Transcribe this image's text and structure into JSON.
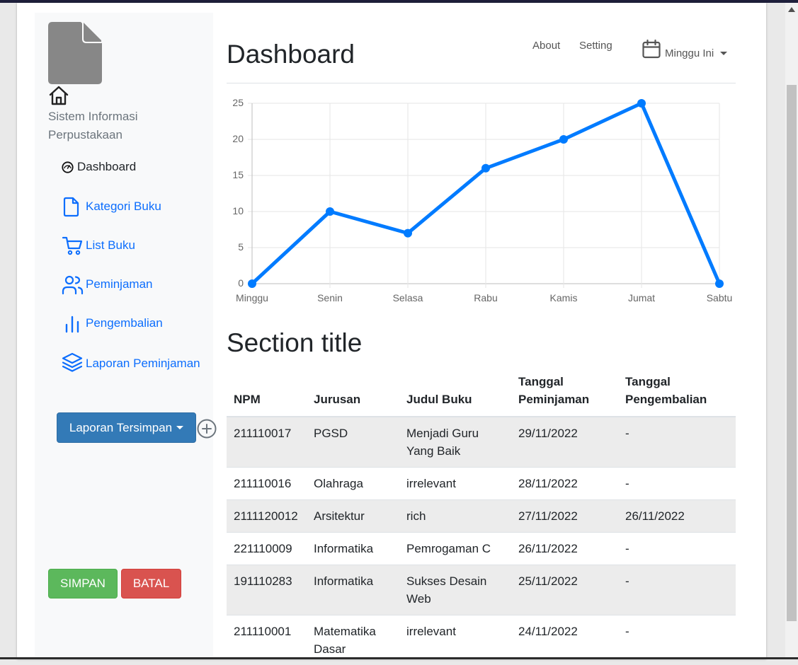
{
  "app": {
    "title": "Sistem Informasi Perpustakaan"
  },
  "sidebar": {
    "items": [
      {
        "label": "Dashboard",
        "icon": "speedometer-icon",
        "active": true
      },
      {
        "label": "Kategori Buku",
        "icon": "file-icon"
      },
      {
        "label": "List Buku",
        "icon": "cart-icon"
      },
      {
        "label": "Peminjaman",
        "icon": "users-icon"
      },
      {
        "label": "Pengembalian",
        "icon": "bar-chart-icon"
      },
      {
        "label": "Laporan Peminjaman",
        "icon": "layers-icon"
      }
    ],
    "saved_reports_label": "Laporan Tersimpan",
    "save_label": "SIMPAN",
    "cancel_label": "BATAL"
  },
  "header": {
    "title": "Dashboard",
    "links": [
      "About",
      "Setting"
    ],
    "period_label": "Minggu Ini"
  },
  "chart_data": {
    "type": "line",
    "categories": [
      "Minggu",
      "Senin",
      "Selasa",
      "Rabu",
      "Kamis",
      "Jumat",
      "Sabtu"
    ],
    "series": [
      {
        "values": [
          0,
          10,
          7,
          16,
          20,
          25,
          0
        ],
        "color": "#007bff"
      }
    ],
    "ylim": [
      0,
      25
    ],
    "yticks": [
      0,
      5,
      10,
      15,
      20,
      25
    ],
    "grid": true,
    "legend": "none"
  },
  "section": {
    "title": "Section title"
  },
  "table": {
    "headers": [
      "NPM",
      "Jurusan",
      "Judul Buku",
      "Tanggal Peminjaman",
      "Tanggal Pengembalian"
    ],
    "rows": [
      [
        "211110017",
        "PGSD",
        "Menjadi Guru Yang Baik",
        "29/11/2022",
        "-"
      ],
      [
        "211110016",
        "Olahraga",
        "irrelevant",
        "28/11/2022",
        "-"
      ],
      [
        "2111120012",
        "Arsitektur",
        "rich",
        "27/11/2022",
        "26/11/2022"
      ],
      [
        "221110009",
        "Informatika",
        "Pemrogaman C",
        "26/11/2022",
        "-"
      ],
      [
        "191110283",
        "Informatika",
        "Sukses Desain Web",
        "25/11/2022",
        "-"
      ],
      [
        "211110001",
        "Matematika Dasar",
        "irrelevant",
        "24/11/2022",
        "-"
      ]
    ]
  },
  "colors": {
    "primary": "#0d6efd",
    "chart_line": "#007bff",
    "dropdown_button": "#337ab7",
    "save_button": "#5cb85c",
    "cancel_button": "#d9534f"
  }
}
